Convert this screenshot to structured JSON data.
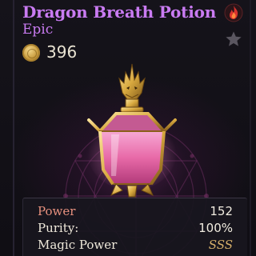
{
  "item": {
    "name": "Dragon Breath Potion",
    "rarity": "Epic",
    "price": "396",
    "accent_color": "#c97bf2"
  },
  "icons": {
    "coin": "gold-coin-icon",
    "fire": "fire-icon",
    "favorite": "star-icon",
    "artwork": "dragon-potion-bottle"
  },
  "stats": [
    {
      "label": "Power",
      "value": "152"
    },
    {
      "label": "Purity:",
      "value": "100%"
    },
    {
      "label": "Magic Power",
      "value": "SSS"
    }
  ]
}
